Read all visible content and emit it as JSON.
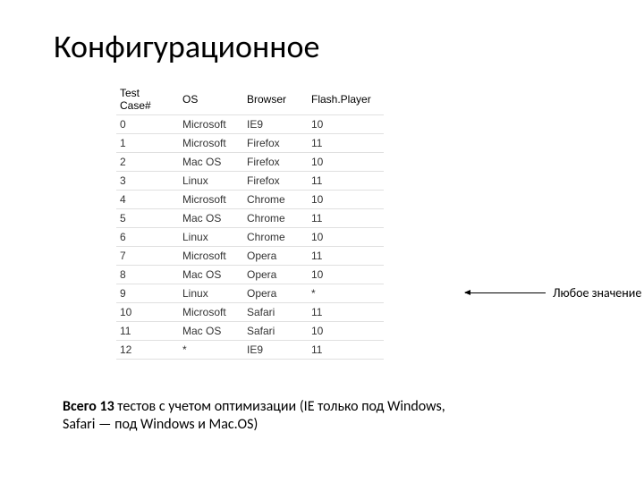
{
  "title": "Конфигурационное",
  "table": {
    "headers": [
      "Test Case#",
      "OS",
      "Browser",
      "Flash.Player"
    ],
    "rows": [
      [
        "0",
        "Microsoft",
        "IE9",
        "10"
      ],
      [
        "1",
        "Microsoft",
        "Firefox",
        "11"
      ],
      [
        "2",
        "Mac OS",
        "Firefox",
        "10"
      ],
      [
        "3",
        "Linux",
        "Firefox",
        "11"
      ],
      [
        "4",
        "Microsoft",
        "Chrome",
        "10"
      ],
      [
        "5",
        "Mac OS",
        "Chrome",
        "11"
      ],
      [
        "6",
        "Linux",
        "Chrome",
        "10"
      ],
      [
        "7",
        "Microsoft",
        "Opera",
        "11"
      ],
      [
        "8",
        "Mac OS",
        "Opera",
        "10"
      ],
      [
        "9",
        "Linux",
        "Opera",
        "*"
      ],
      [
        "10",
        "Microsoft",
        "Safari",
        "11"
      ],
      [
        "11",
        "Mac OS",
        "Safari",
        "10"
      ],
      [
        "12",
        "*",
        "IE9",
        "11"
      ]
    ]
  },
  "annotation": "Любое значение",
  "summary_bold": "Всего 13",
  "summary_rest": " тестов с учетом оптимизации (IE только под Windows, Safari — под Windows и Mac.OS)"
}
